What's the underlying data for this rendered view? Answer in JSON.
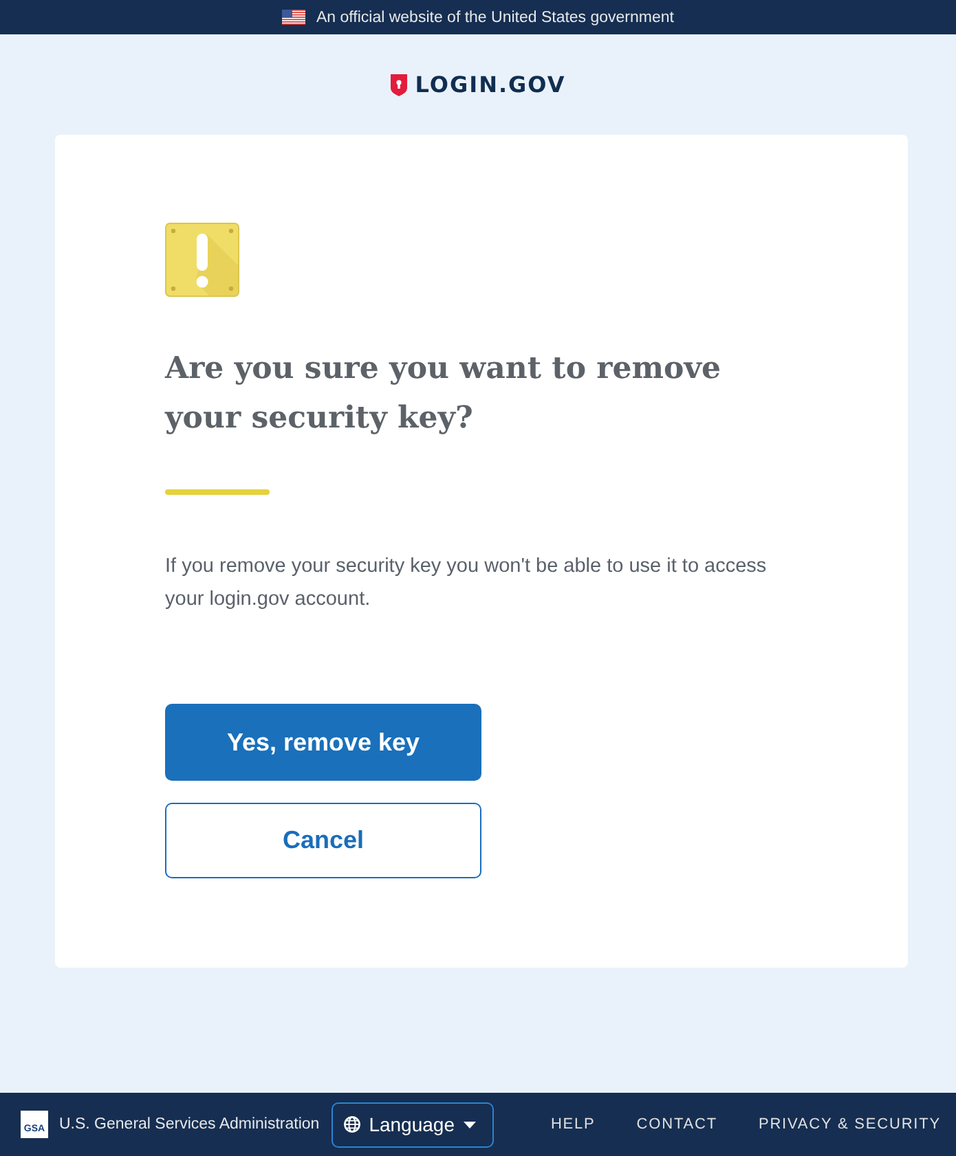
{
  "banner": {
    "text": "An official website of the United States government"
  },
  "header": {
    "logo_text": "LOGIN.GOV"
  },
  "card": {
    "title": "Are you sure you want to remove your security key?",
    "message": "If you remove your security key you won't be able to use it to access your login.gov account.",
    "buttons": [
      {
        "label": "Yes, remove key",
        "kind": "primary"
      },
      {
        "label": "Cancel",
        "kind": "secondary"
      }
    ]
  },
  "footer": {
    "agency": {
      "logo_text": "GSA",
      "name": "U.S. General Services Administration"
    },
    "language": {
      "label": "Language"
    },
    "links": [
      "HELP",
      "CONTACT",
      "PRIVACY & SECURITY"
    ]
  }
}
